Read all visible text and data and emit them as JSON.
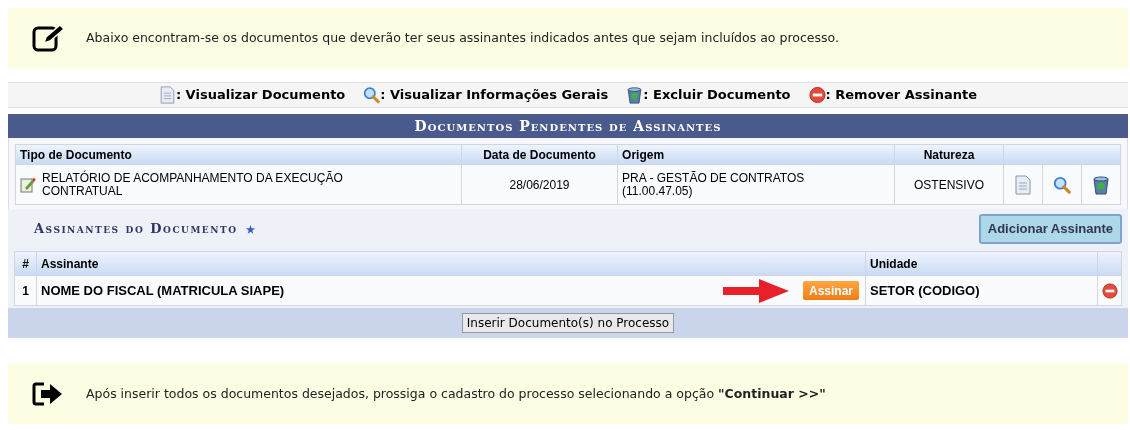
{
  "top_notice": {
    "text": "Abaixo encontram-se os documentos que deverão ter seus assinantes indicados antes que sejam incluídos ao processo."
  },
  "legend": [
    {
      "kind": "view",
      "label": ": Visualizar Documento"
    },
    {
      "kind": "info",
      "label": ": Visualizar Informações Gerais"
    },
    {
      "kind": "delete",
      "label": ": Excluir Documento"
    },
    {
      "kind": "remove",
      "label": ": Remover Assinante"
    }
  ],
  "documents": {
    "title": "Documentos Pendentes de Assinantes",
    "columns": [
      "Tipo de Documento",
      "Data de Documento",
      "Origem",
      "Natureza"
    ],
    "rows": [
      {
        "tipo": "RELATÓRIO DE ACOMPANHAMENTO DA EXECUÇÃO CONTRATUAL",
        "data": "28/06/2019",
        "origem": "PRA - GESTÃO DE CONTRATOS (11.00.47.05)",
        "natureza": "OSTENSIVO",
        "actions": [
          {
            "kind": "view"
          },
          {
            "kind": "info"
          },
          {
            "kind": "delete"
          }
        ]
      }
    ]
  },
  "signers": {
    "title": "Assinantes do Documento",
    "add_button": "Adicionar Assinante",
    "columns": [
      "#",
      "Assinante",
      "Unidade"
    ],
    "rows": [
      {
        "index": "1",
        "name": "NOME DO FISCAL (MATRICULA SIAPE)",
        "sign_button": "Assinar",
        "unit": "SETOR (CODIGO)"
      }
    ]
  },
  "insert_button": "Inserir Documento(s) no Processo",
  "bottom_notice": {
    "text": "Após inserir todos os documentos desejados, prossiga o cadastro do processo selecionando a opção **\"Continuar >>\"**"
  }
}
